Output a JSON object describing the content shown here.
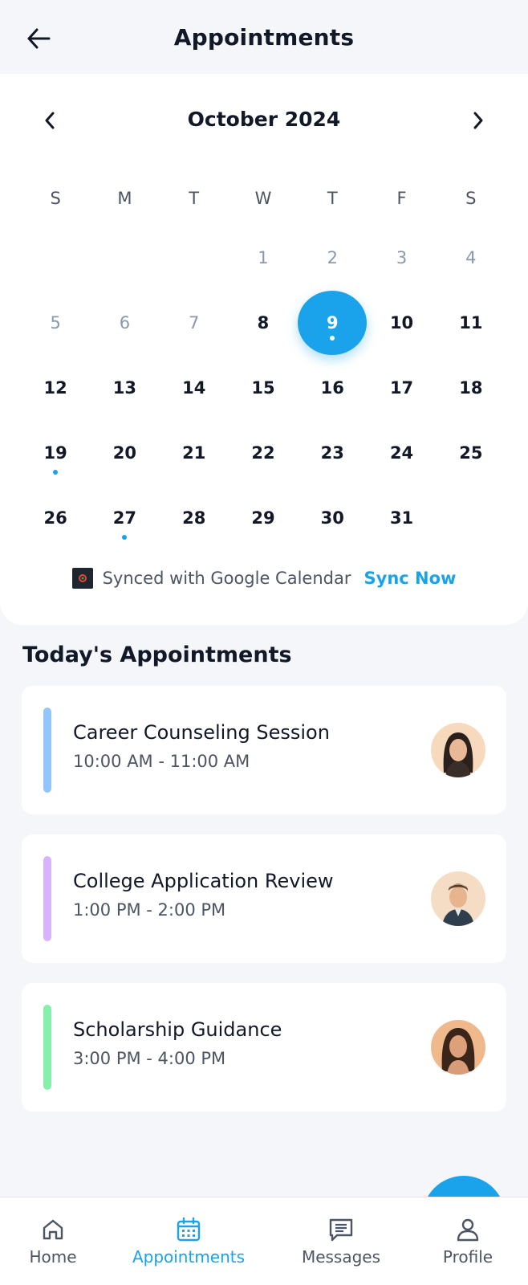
{
  "header": {
    "title": "Appointments"
  },
  "calendar": {
    "month_label": "October 2024",
    "weekdays": [
      "S",
      "M",
      "T",
      "W",
      "T",
      "F",
      "S"
    ],
    "days": [
      {
        "label": "",
        "muted": false
      },
      {
        "label": "",
        "muted": false
      },
      {
        "label": "",
        "muted": false
      },
      {
        "label": "1",
        "muted": true
      },
      {
        "label": "2",
        "muted": true
      },
      {
        "label": "3",
        "muted": true
      },
      {
        "label": "4",
        "muted": true
      },
      {
        "label": "5",
        "muted": true
      },
      {
        "label": "6",
        "muted": true
      },
      {
        "label": "7",
        "muted": true
      },
      {
        "label": "8",
        "muted": false
      },
      {
        "label": "9",
        "muted": false,
        "selected": true,
        "event": true
      },
      {
        "label": "10",
        "muted": false
      },
      {
        "label": "11",
        "muted": false
      },
      {
        "label": "12",
        "muted": false
      },
      {
        "label": "13",
        "muted": false
      },
      {
        "label": "14",
        "muted": false
      },
      {
        "label": "15",
        "muted": false
      },
      {
        "label": "16",
        "muted": false
      },
      {
        "label": "17",
        "muted": false
      },
      {
        "label": "18",
        "muted": false
      },
      {
        "label": "19",
        "muted": false,
        "event": true
      },
      {
        "label": "20",
        "muted": false
      },
      {
        "label": "21",
        "muted": false
      },
      {
        "label": "22",
        "muted": false
      },
      {
        "label": "23",
        "muted": false
      },
      {
        "label": "24",
        "muted": false
      },
      {
        "label": "25",
        "muted": false
      },
      {
        "label": "26",
        "muted": false
      },
      {
        "label": "27",
        "muted": false,
        "event": true
      },
      {
        "label": "28",
        "muted": false
      },
      {
        "label": "29",
        "muted": false
      },
      {
        "label": "30",
        "muted": false
      },
      {
        "label": "31",
        "muted": false
      }
    ],
    "sync_text": "Synced with Google Calendar",
    "sync_action": "Sync Now"
  },
  "today": {
    "title": "Today's Appointments",
    "appointments": [
      {
        "title": "Career Counseling Session",
        "time": "10:00 AM - 11:00 AM",
        "accent": "#93c5fd",
        "avatar": "woman-avatar"
      },
      {
        "title": "College Application Review",
        "time": "1:00 PM - 2:00 PM",
        "accent": "#d8b4fe",
        "avatar": "man-avatar"
      },
      {
        "title": "Scholarship Guidance",
        "time": "3:00 PM - 4:00 PM",
        "accent": "#86efac",
        "avatar": "woman-avatar"
      }
    ]
  },
  "nav": {
    "items": [
      {
        "label": "Home",
        "icon": "home-icon",
        "active": false
      },
      {
        "label": "Appointments",
        "icon": "calendar-icon",
        "active": true
      },
      {
        "label": "Messages",
        "icon": "message-icon",
        "active": false
      },
      {
        "label": "Profile",
        "icon": "profile-icon",
        "active": false
      }
    ]
  },
  "colors": {
    "accent": "#1aa3ea",
    "background": "#f4f6f9",
    "text": "#111827",
    "muted": "#8a98ad"
  }
}
